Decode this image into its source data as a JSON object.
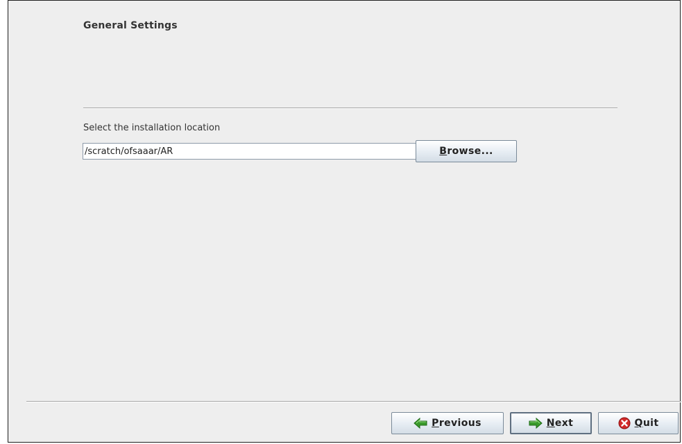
{
  "page": {
    "title": "General Settings"
  },
  "location": {
    "label": "Select the installation location",
    "path_value": "/scratch/ofsaaar/AR",
    "browse_label_mnemonic": "B",
    "browse_label_rest": "rowse..."
  },
  "nav": {
    "previous_mnemonic": "P",
    "previous_rest": "revious",
    "next_mnemonic": "N",
    "next_rest": "ext",
    "quit_mnemonic": "Q",
    "quit_rest": "uit"
  },
  "icons": {
    "previous": "green-left-arrow-icon",
    "next": "green-right-arrow-icon",
    "quit": "red-x-circle-icon"
  },
  "colors": {
    "arrow_green": "#3a9a2c",
    "quit_red": "#d22a2a"
  }
}
